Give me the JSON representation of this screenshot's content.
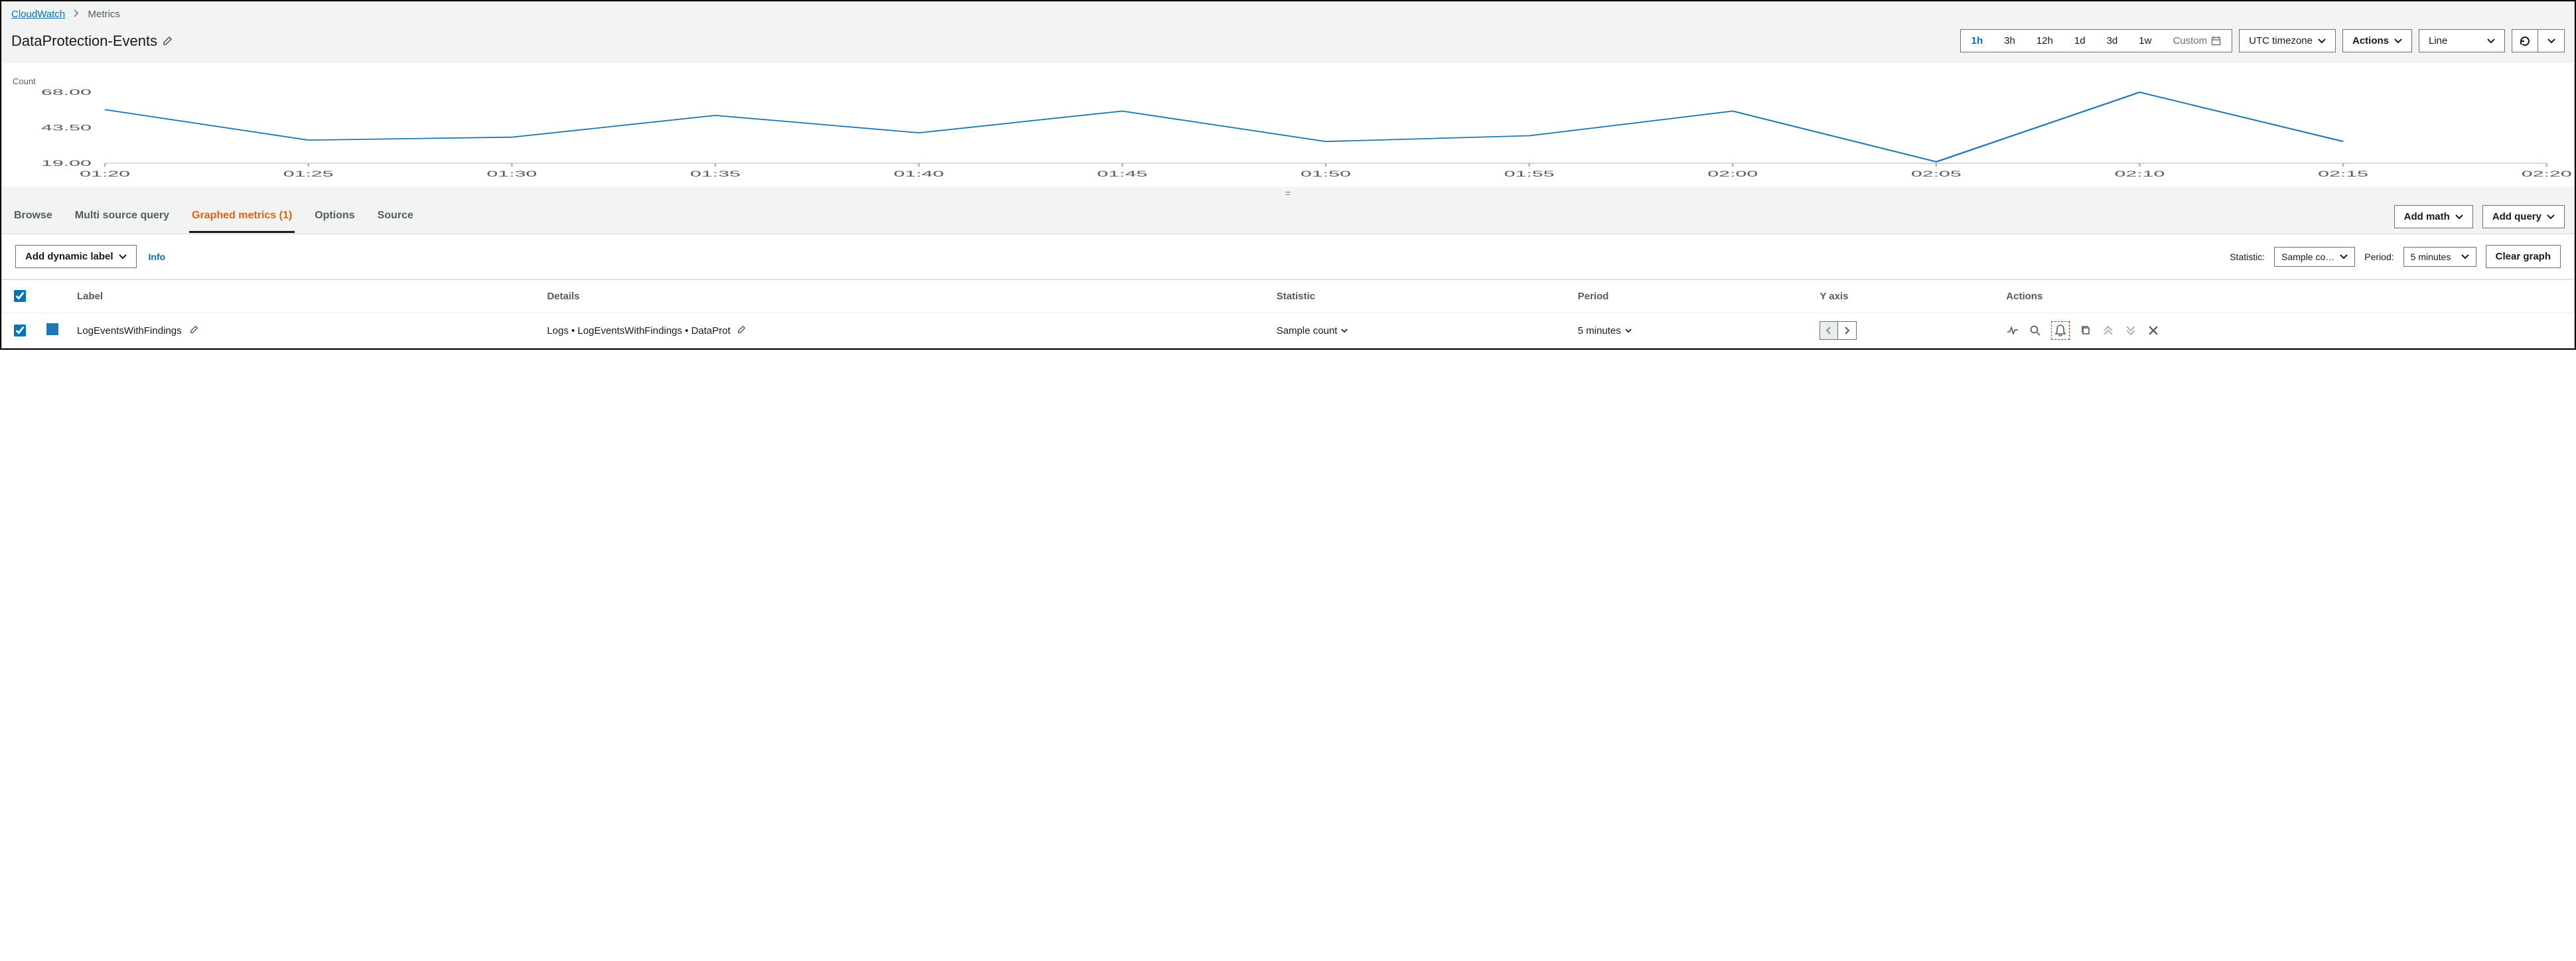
{
  "breadcrumbs": {
    "root": "CloudWatch",
    "current": "Metrics"
  },
  "title": "DataProtection-Events",
  "time_ranges": [
    "1h",
    "3h",
    "12h",
    "1d",
    "3d",
    "1w"
  ],
  "time_active": "1h",
  "custom_label": "Custom",
  "timezone_label": "UTC timezone",
  "actions_label": "Actions",
  "viz_type": "Line",
  "tabs": {
    "browse": "Browse",
    "multi": "Multi source query",
    "graphed": "Graphed metrics (1)",
    "options": "Options",
    "source": "Source"
  },
  "add_math": "Add math",
  "add_query": "Add query",
  "add_dynamic": "Add dynamic label",
  "info": "Info",
  "statistic_label": "Statistic:",
  "statistic_value": "Sample co…",
  "period_label": "Period:",
  "period_value": "5 minutes",
  "clear_graph": "Clear graph",
  "table": {
    "headers": {
      "label": "Label",
      "details": "Details",
      "statistic": "Statistic",
      "period": "Period",
      "yaxis": "Y axis",
      "actions": "Actions"
    },
    "row": {
      "label": "LogEventsWithFindings",
      "details": "Logs • LogEventsWithFindings • DataProt",
      "statistic": "Sample count",
      "period": "5 minutes"
    }
  },
  "chart_data": {
    "type": "line",
    "title": "",
    "ylabel": "Count",
    "xlabel": "",
    "ylim": [
      19,
      68
    ],
    "yticks": [
      19.0,
      43.5,
      68.0
    ],
    "categories": [
      "01:20",
      "01:25",
      "01:30",
      "01:35",
      "01:40",
      "01:45",
      "01:50",
      "01:55",
      "02:00",
      "02:05",
      "02:10",
      "02:15",
      "02:20"
    ],
    "series": [
      {
        "name": "LogEventsWithFindings",
        "color": "#1f77b4",
        "values": [
          56,
          35,
          37,
          52,
          40,
          55,
          34,
          38,
          55,
          20,
          68,
          34,
          null
        ]
      }
    ]
  }
}
